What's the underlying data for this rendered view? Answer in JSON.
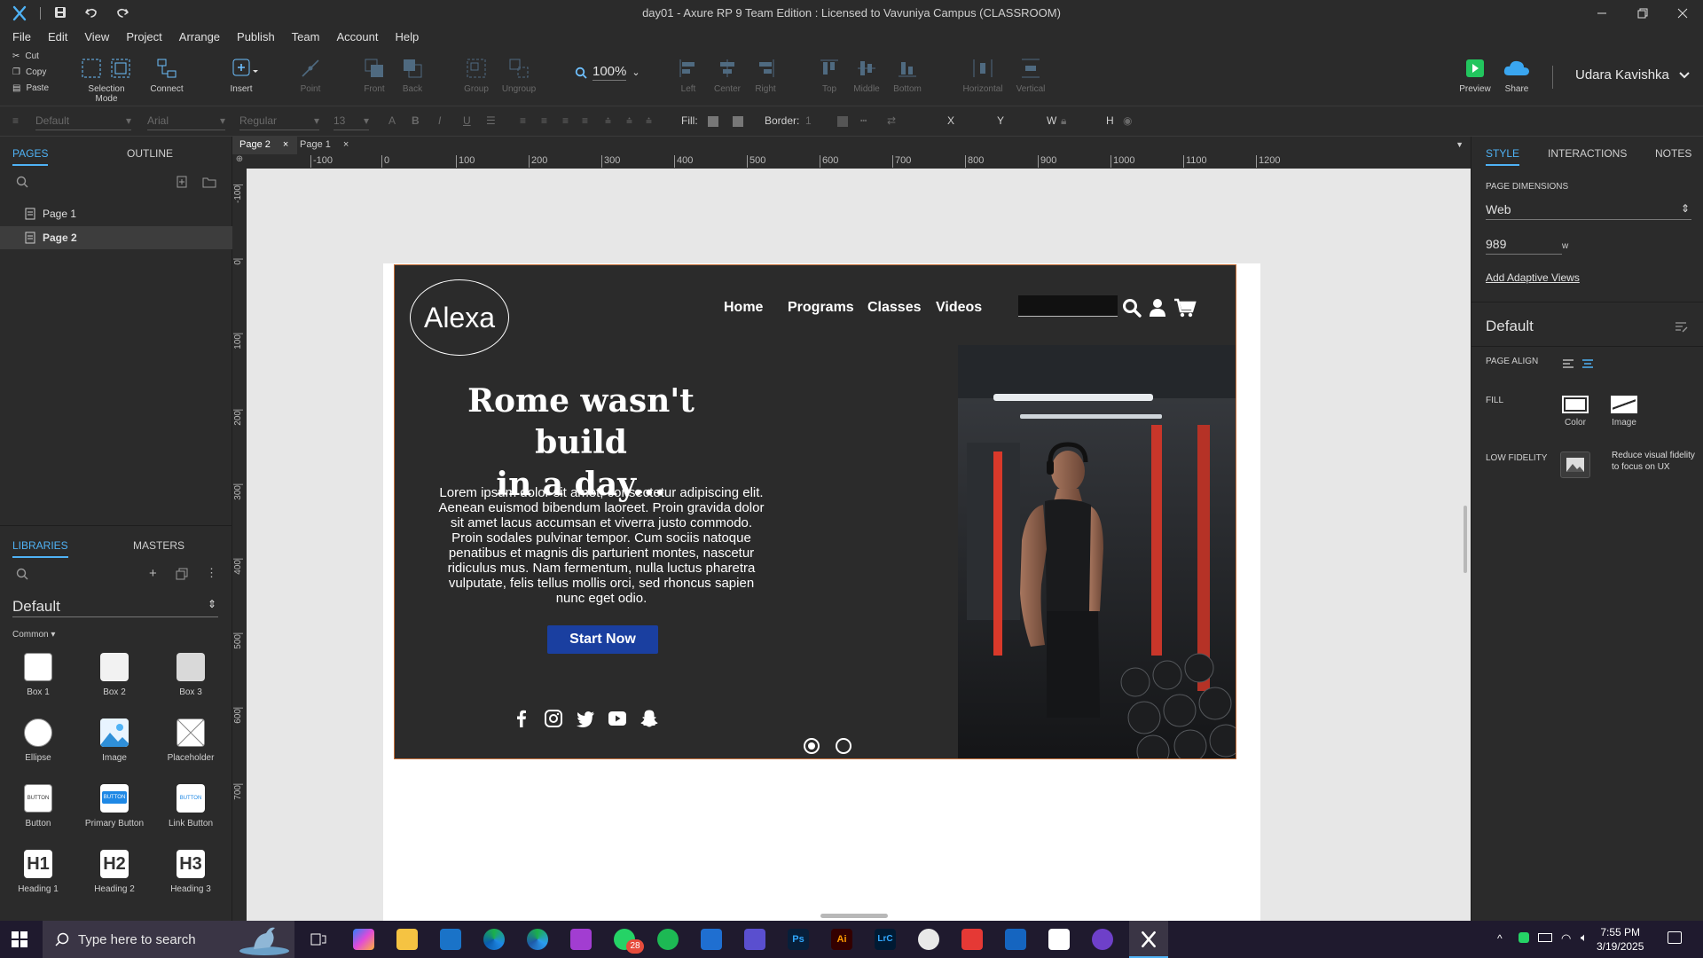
{
  "window": {
    "title": "day01 - Axure RP 9 Team Edition : Licensed to Vavuniya Campus (CLASSROOM)"
  },
  "menu": [
    "File",
    "Edit",
    "View",
    "Project",
    "Arrange",
    "Publish",
    "Team",
    "Account",
    "Help"
  ],
  "clipboard": {
    "cut": "Cut",
    "copy": "Copy",
    "paste": "Paste"
  },
  "toolbar": {
    "selection_mode": "Selection Mode",
    "connect": "Connect",
    "insert": "Insert",
    "point": "Point",
    "front": "Front",
    "back": "Back",
    "group": "Group",
    "ungroup": "Ungroup",
    "zoom": "100%",
    "left": "Left",
    "center": "Center",
    "right": "Right",
    "top": "Top",
    "middle": "Middle",
    "bottom": "Bottom",
    "horizontal": "Horizontal",
    "vertical": "Vertical",
    "preview": "Preview",
    "share": "Share",
    "user": "Udara Kavishka"
  },
  "formatbar": {
    "style": "Default",
    "font": "Arial",
    "weight": "Regular",
    "size": "13",
    "fill": "Fill:",
    "border": "Border:",
    "border_val": "1",
    "x": "X",
    "y": "Y",
    "w": "W",
    "h": "H"
  },
  "left_panel": {
    "tabs": [
      "PAGES",
      "OUTLINE"
    ],
    "pages": [
      "Page 1",
      "Page 2"
    ],
    "lib_tabs": [
      "LIBRARIES",
      "MASTERS"
    ],
    "library": "Default",
    "category": "Common ▾",
    "widgets": [
      "Box 1",
      "Box 2",
      "Box 3",
      "Ellipse",
      "Image",
      "Placeholder",
      "Button",
      "Primary Button",
      "Link Button",
      "Heading 1",
      "Heading 2",
      "Heading 3"
    ]
  },
  "doc_tabs": [
    "Page 2",
    "Page 1"
  ],
  "ruler": {
    "h": [
      "-100",
      "0",
      "100",
      "200",
      "300",
      "400",
      "500",
      "600",
      "700",
      "800",
      "900",
      "1000",
      "1100",
      "1200"
    ],
    "v": [
      "-100",
      "0",
      "100",
      "200",
      "300",
      "400",
      "500",
      "600",
      "700"
    ]
  },
  "site": {
    "logo": "Alexa",
    "nav": [
      "Home",
      "Programs",
      "Classes",
      "Videos"
    ],
    "headline_1": "Rome wasn't build",
    "headline_2": "in a day...",
    "body": "Lorem ipsum dolor sit amet, consectetur adipiscing elit. Aenean euismod bibendum laoreet. Proin gravida dolor sit amet lacus accumsan et viverra justo commodo. Proin sodales pulvinar tempor. Cum sociis natoque penatibus et magnis dis parturient montes, nascetur ridiculus mus. Nam fermentum, nulla luctus pharetra vulputate, felis tellus mollis orci, sed rhoncus sapien nunc eget odio.",
    "cta": "Start Now",
    "social": [
      "facebook-icon",
      "instagram-icon",
      "twitter-icon",
      "youtube-icon",
      "snapchat-icon"
    ]
  },
  "right_panel": {
    "tabs": [
      "STYLE",
      "INTERACTIONS",
      "NOTES"
    ],
    "page_dimensions": "PAGE DIMENSIONS",
    "dimension_type": "Web",
    "width": "989",
    "w_label": "w",
    "adaptive": "Add Adaptive Views",
    "style_name": "Default",
    "page_align": "PAGE ALIGN",
    "fill": "FILL",
    "fill_color": "Color",
    "fill_image": "Image",
    "low_fidelity": "LOW FIDELITY",
    "low_fidelity_desc": "Reduce visual fidelity to focus on UX"
  },
  "taskbar": {
    "search": "Type here to search",
    "badge": "28",
    "time": "7:55 PM",
    "date": "3/19/2025"
  },
  "colors": {
    "accent": "#4fb2f5",
    "cta": "#1a3fa0",
    "site_bg": "#2b2b2b"
  }
}
